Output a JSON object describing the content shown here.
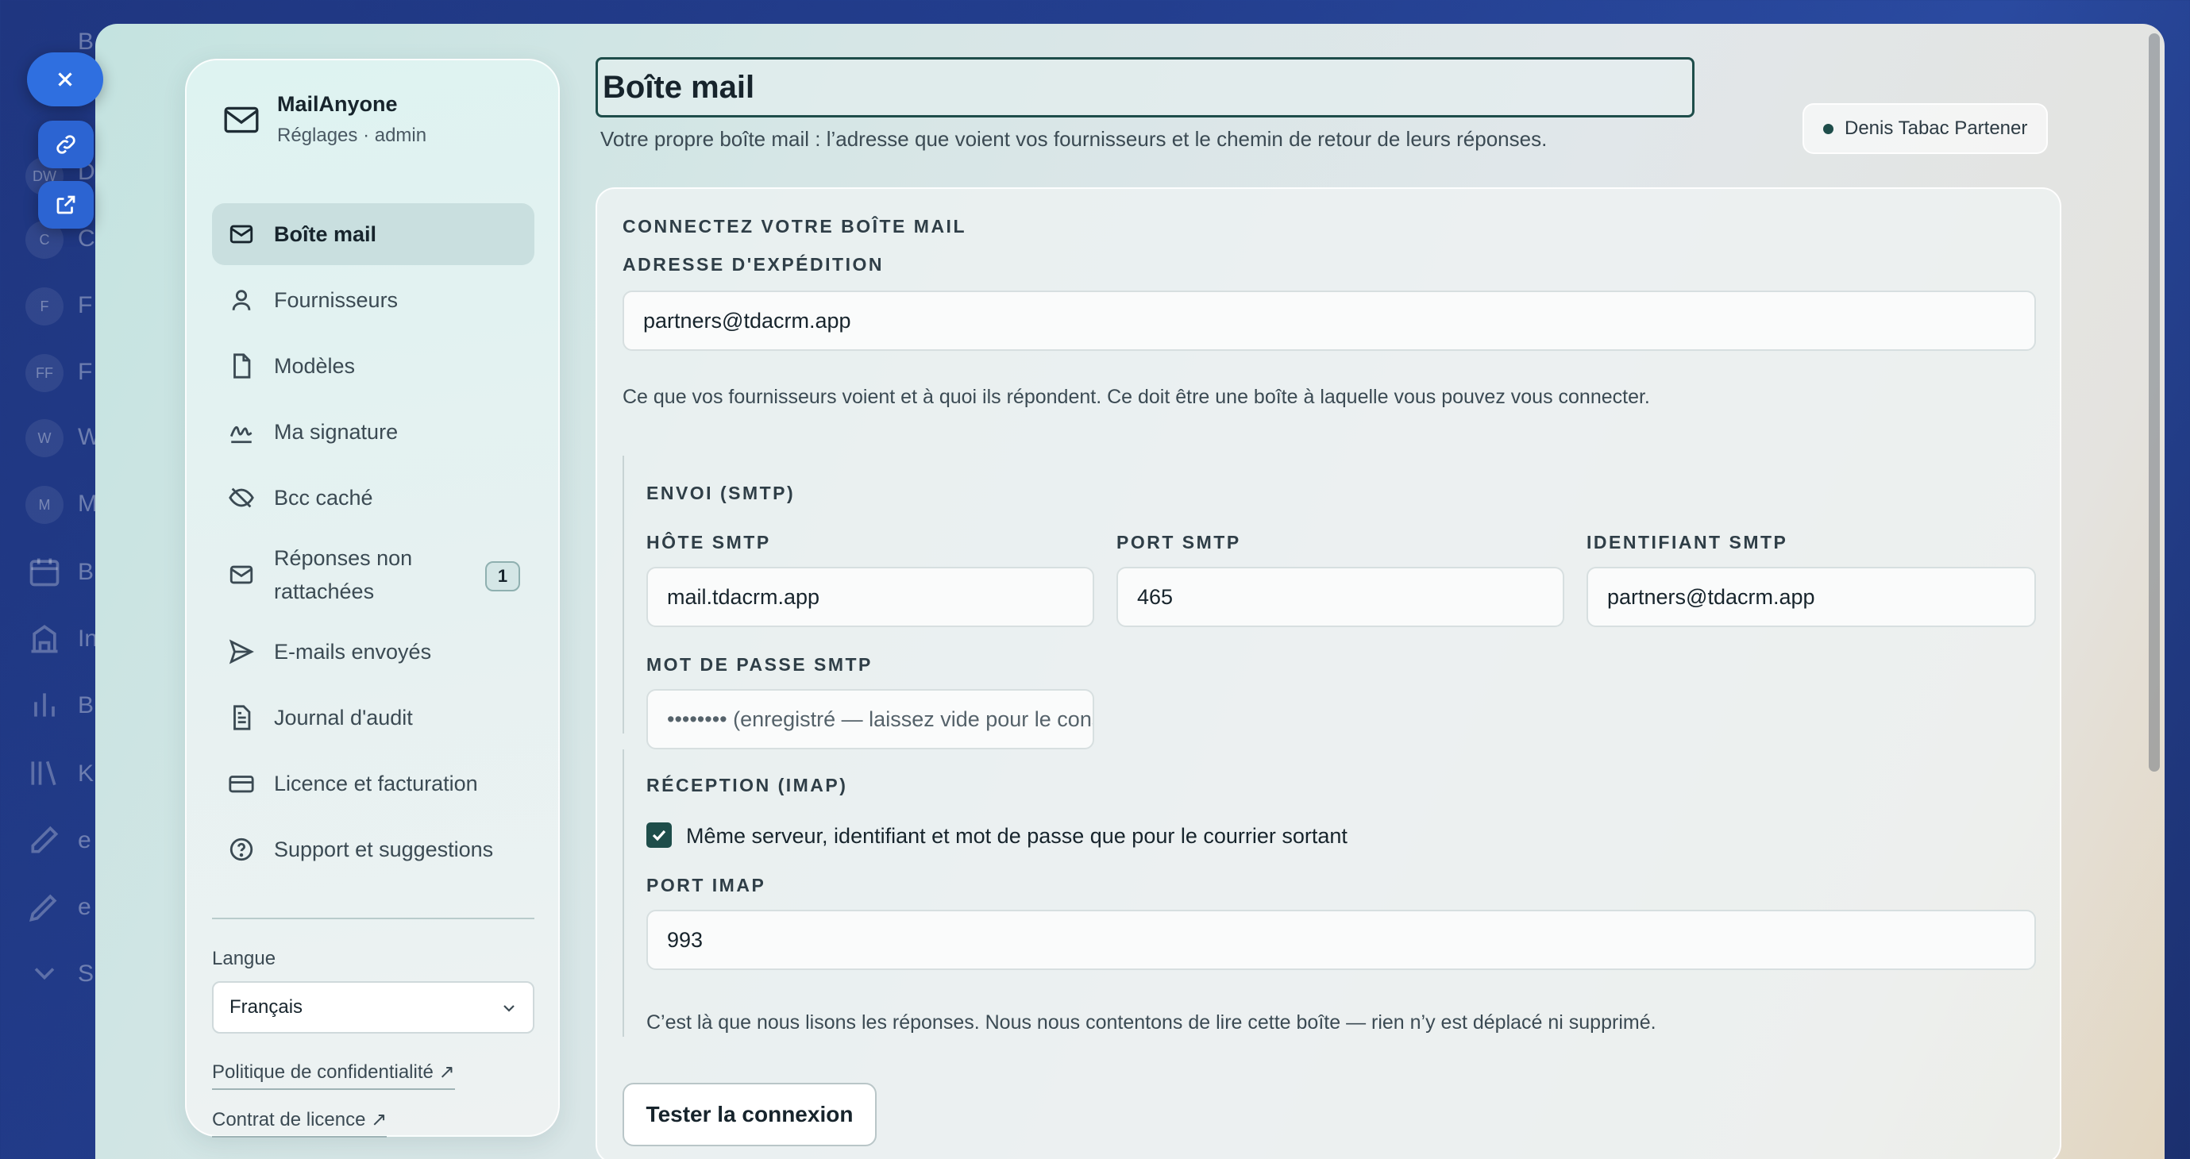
{
  "background_app": {
    "rail_initials": [
      "DW",
      "C",
      "F",
      "FF",
      "W",
      "M"
    ],
    "rail_letters": [
      "B",
      "D",
      "C",
      "F",
      "F",
      "W",
      "M",
      "B",
      "In",
      "B",
      "K",
      "e",
      "e",
      "S"
    ]
  },
  "sidebar": {
    "brand_name": "MailAnyone",
    "brand_sub": "Réglages · admin",
    "items": [
      {
        "label": "Boîte mail",
        "icon": "mail-icon",
        "active": true
      },
      {
        "label": "Fournisseurs",
        "icon": "user-icon"
      },
      {
        "label": "Modèles",
        "icon": "file-icon"
      },
      {
        "label": "Ma signature",
        "icon": "signature-icon"
      },
      {
        "label": "Bcc caché",
        "icon": "eye-off-icon"
      },
      {
        "label": "Réponses non rattachées",
        "icon": "mail-icon",
        "badge": "1"
      },
      {
        "label": "E-mails envoyés",
        "icon": "send-icon"
      },
      {
        "label": "Journal d'audit",
        "icon": "document-icon"
      },
      {
        "label": "Licence et facturation",
        "icon": "credit-card-icon"
      },
      {
        "label": "Support et suggestions",
        "icon": "help-circle-icon"
      }
    ],
    "language_label": "Langue",
    "language_value": "Français",
    "privacy_link": "Politique de confidentialité ↗",
    "license_link": "Contrat de licence ↗"
  },
  "header": {
    "title": "Boîte mail",
    "subtitle": "Votre propre boîte mail : l’adresse que voient vos fournisseurs et le chemin de retour de leurs réponses.",
    "user": "Denis Tabac Partener"
  },
  "form": {
    "section_title": "CONNECTEZ VOTRE BOÎTE MAIL",
    "sender_label": "ADRESSE D'EXPÉDITION",
    "sender_value": "partners@tdacrm.app",
    "sender_help": "Ce que vos fournisseurs voient et à quoi ils répondent. Ce doit être une boîte à laquelle vous pouvez vous connecter.",
    "smtp": {
      "title": "ENVOI (SMTP)",
      "host_label": "HÔTE SMTP",
      "host_value": "mail.tdacrm.app",
      "port_label": "PORT SMTP",
      "port_value": "465",
      "user_label": "IDENTIFIANT SMTP",
      "user_value": "partners@tdacrm.app",
      "password_label": "MOT DE PASSE SMTP",
      "password_placeholder": "•••••••• (enregistré — laissez vide pour le conserver)"
    },
    "imap": {
      "title": "RÉCEPTION (IMAP)",
      "same_server_label": "Même serveur, identifiant et mot de passe que pour le courrier sortant",
      "same_server_checked": true,
      "port_label": "PORT IMAP",
      "port_value": "993",
      "help": "C’est là que nous lisons les réponses. Nous nous contentons de lire cette boîte — rien n’y est déplacé ni supprimé."
    },
    "test_button": "Tester la connexion"
  },
  "colors": {
    "accent": "#1e4d4a",
    "float_button": "#2f6fe0"
  }
}
